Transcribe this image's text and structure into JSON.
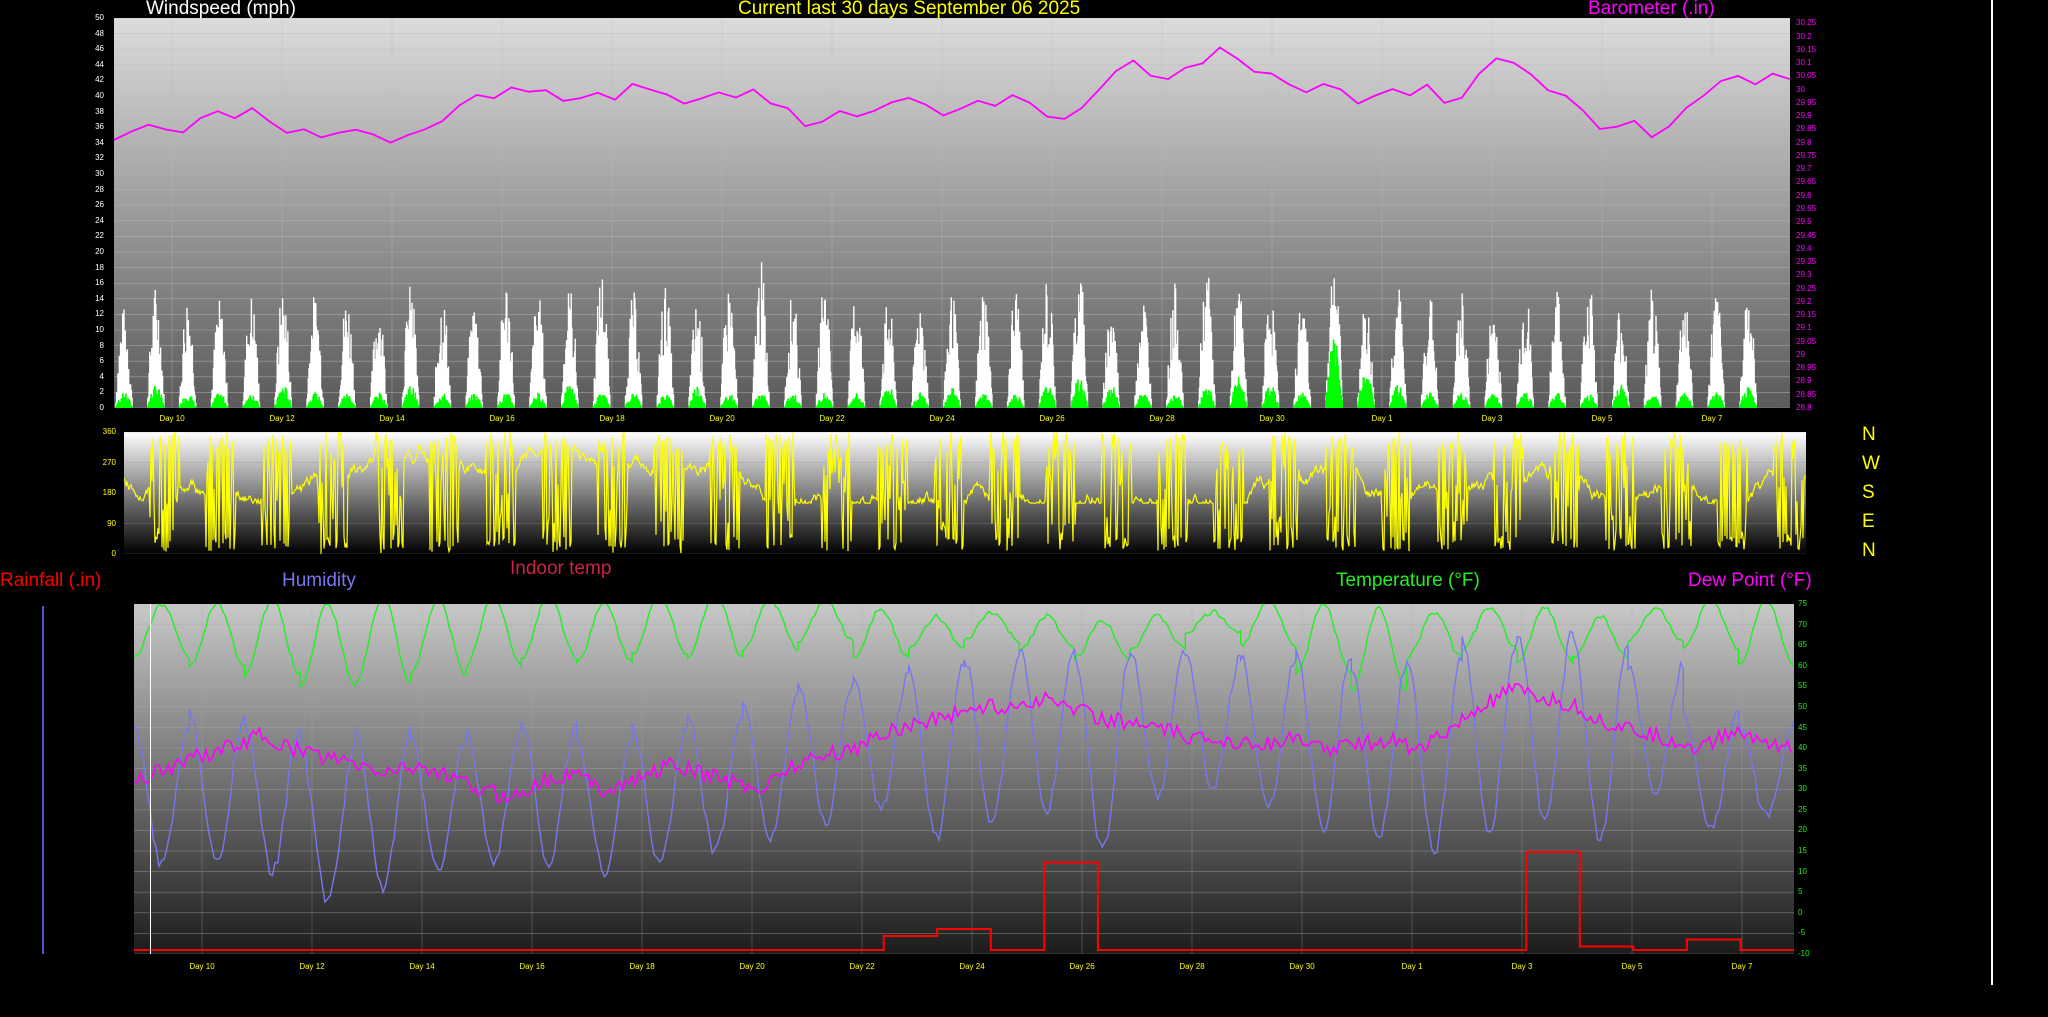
{
  "chart_data": [
    {
      "type": "line",
      "title": "Current last 30 days September 06 2025",
      "left_axis_label": "Windspeed (mph)",
      "right_axis_label": "Barometer (.in)",
      "x_tick_labels": [
        "Day 10",
        "Day 12",
        "Day 14",
        "Day 16",
        "Day 18",
        "Day 20",
        "Day 22",
        "Day 24",
        "Day 26",
        "Day 28",
        "Day 30",
        "Day 1",
        "Day 3",
        "Day 5",
        "Day 7"
      ],
      "left_ticks": [
        0,
        2,
        4,
        6,
        8,
        10,
        12,
        14,
        16,
        18,
        20,
        22,
        24,
        26,
        28,
        30,
        32,
        34,
        36,
        38,
        40,
        42,
        44,
        46,
        48,
        50
      ],
      "left_range": [
        0,
        50
      ],
      "right_ticks": [
        "28.8",
        "28.85",
        "28.9",
        "28.95",
        "29",
        "29.05",
        "29.1",
        "29.15",
        "29.2",
        "29.25",
        "29.3",
        "29.35",
        "29.4",
        "29.45",
        "29.5",
        "29.55",
        "29.6",
        "29.65",
        "29.7",
        "29.75",
        "29.8",
        "29.85",
        "29.9",
        "29.95",
        "30",
        "30.05",
        "30.1",
        "30.15",
        "30.2",
        "30.25"
      ],
      "right_range": [
        28.8,
        30.27
      ],
      "barometer_series": [
        29.81,
        29.84,
        29.87,
        29.85,
        29.84,
        29.89,
        29.92,
        29.89,
        29.93,
        29.88,
        29.84,
        29.85,
        29.82,
        29.84,
        29.85,
        29.83,
        29.8,
        29.83,
        29.85,
        29.88,
        29.94,
        29.98,
        29.97,
        30.01,
        29.99,
        30.0,
        29.96,
        29.97,
        29.99,
        29.96,
        30.02,
        30.0,
        29.98,
        29.95,
        29.97,
        29.99,
        29.97,
        30.0,
        29.95,
        29.93,
        29.86,
        29.88,
        29.92,
        29.9,
        29.92,
        29.95,
        29.97,
        29.94,
        29.9,
        29.93,
        29.96,
        29.94,
        29.98,
        29.95,
        29.9,
        29.89,
        29.93,
        30.0,
        30.07,
        30.11,
        30.05,
        30.04,
        30.08,
        30.1,
        30.16,
        30.12,
        30.07,
        30.06,
        30.02,
        29.99,
        30.02,
        30.0,
        29.95,
        29.98,
        30.0,
        29.98,
        30.02,
        29.95,
        29.97,
        30.06,
        30.12,
        30.1,
        30.06,
        30.0,
        29.98,
        29.92,
        29.85,
        29.86,
        29.88,
        29.82,
        29.86,
        29.93,
        29.98,
        30.03,
        30.05,
        30.02,
        30.06,
        30.04
      ],
      "wind_gust_peaks": [
        13,
        16,
        15,
        14,
        15,
        16,
        15,
        15,
        14,
        16,
        15,
        14,
        17,
        15,
        16,
        18,
        15,
        16,
        14,
        16,
        19,
        15,
        17,
        16,
        14,
        15,
        15,
        16,
        16,
        17,
        19,
        14,
        15,
        16,
        18,
        16,
        15,
        15,
        20,
        14,
        16,
        15,
        15,
        14,
        16,
        15,
        17,
        14,
        16,
        15,
        15,
        16
      ],
      "wind_avg_peaks": [
        2,
        3,
        2,
        2,
        2,
        3,
        2,
        2,
        2,
        3,
        2,
        2,
        2,
        2,
        3,
        2,
        2,
        2,
        3,
        2,
        2,
        2,
        2,
        2,
        3,
        2,
        3,
        2,
        2,
        3,
        4,
        3,
        2,
        2,
        3,
        4,
        3,
        2,
        9,
        5,
        3,
        2,
        2,
        2,
        2,
        2,
        2,
        3,
        2,
        2,
        2,
        3
      ],
      "colors": {
        "barometer": "#ff00ff",
        "gust": "#ffffff",
        "average": "#00ff00",
        "title": "#ffff00",
        "left_label": "#ffffff"
      }
    },
    {
      "type": "line",
      "series_name": "Wind direction",
      "y_ticks": [
        0,
        90,
        180,
        270,
        360
      ],
      "y_range": [
        0,
        360
      ],
      "compass_labels": [
        "N",
        "W",
        "S",
        "E",
        "N"
      ],
      "colors": {
        "direction": "#ffff00"
      }
    },
    {
      "type": "line",
      "axis_labels": [
        "Rainfall (.in)",
        "Humidity",
        "Indoor temp",
        "Temperature (°F)",
        "Dew Point (°F)"
      ],
      "x_tick_labels": [
        "Day 10",
        "Day 12",
        "Day 14",
        "Day 16",
        "Day 18",
        "Day 20",
        "Day 22",
        "Day 24",
        "Day 26",
        "Day 28",
        "Day 30",
        "Day 1",
        "Day 3",
        "Day 5",
        "Day 7"
      ],
      "right_ticks": [
        -10,
        -5,
        0,
        5,
        10,
        15,
        20,
        25,
        30,
        35,
        40,
        45,
        50,
        55,
        60,
        65,
        70,
        75
      ],
      "right_range": [
        -10,
        75
      ],
      "temperature_daily_min": [
        62,
        60,
        58,
        55,
        56,
        58,
        60,
        62,
        61,
        63,
        62,
        64,
        66,
        62,
        64,
        66,
        64,
        62,
        64,
        68,
        65,
        58,
        54,
        62,
        64,
        61,
        62,
        66,
        64,
        60
      ],
      "temperature_daily_max": [
        75,
        75,
        76,
        75,
        77,
        76,
        77,
        77,
        75,
        77,
        78,
        76,
        76,
        74,
        72,
        73,
        72,
        71,
        72,
        73,
        76,
        75,
        74,
        73,
        74,
        74,
        72,
        74,
        76,
        76
      ],
      "dew_point_series": [
        32,
        35,
        38,
        40,
        43,
        40,
        38,
        36,
        34,
        36,
        33,
        30,
        28,
        32,
        34,
        30,
        32,
        36,
        34,
        32,
        30,
        36,
        38,
        40,
        44,
        46,
        48,
        50,
        50,
        52,
        50,
        47,
        46,
        44,
        42,
        42,
        41,
        42,
        40,
        41,
        42,
        40,
        44,
        50,
        54,
        52,
        50,
        46,
        44,
        42,
        40,
        44,
        42,
        40
      ],
      "humidity_daily_min": [
        12,
        12,
        10,
        3,
        6,
        10,
        13,
        12,
        10,
        12,
        15,
        18,
        22,
        25,
        18,
        22,
        25,
        15,
        28,
        30,
        25,
        20,
        18,
        15,
        20,
        22,
        18,
        30,
        20,
        24
      ],
      "humidity_daily_max": [
        45,
        48,
        45,
        40,
        44,
        42,
        44,
        46,
        42,
        45,
        48,
        52,
        56,
        58,
        60,
        62,
        64,
        62,
        64,
        62,
        62,
        63,
        60,
        62,
        66,
        68,
        66,
        60,
        48,
        46
      ],
      "rainfall_steps": [
        0,
        0,
        0,
        0,
        0,
        0,
        0,
        0,
        0,
        0,
        0,
        0,
        0,
        0,
        0.04,
        0.06,
        0,
        0.25,
        0,
        0,
        0,
        0,
        0,
        0,
        0,
        0,
        0.28,
        0.01,
        0,
        0.03,
        0
      ],
      "colors": {
        "rainfall": "#ff0000",
        "humidity": "#7777ee",
        "indoor": "#cc2244",
        "temperature": "#22ee22",
        "dew_point": "#ff00ff"
      }
    }
  ]
}
